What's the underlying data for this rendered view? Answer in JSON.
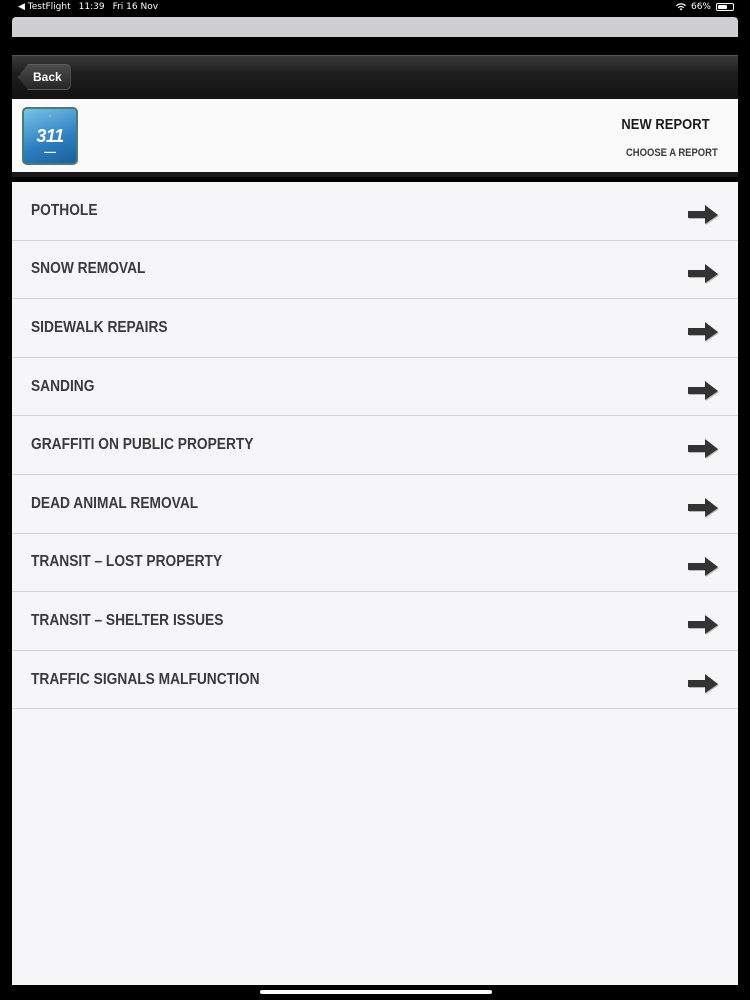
{
  "status_bar": {
    "app": "◀ TestFlight",
    "time": "11:39",
    "date": "Fri 16 Nov",
    "battery": "66%",
    "battery_level": 0.66
  },
  "nav": {
    "back_label": "Back"
  },
  "header": {
    "logo_text": "311",
    "title": "NEW REPORT",
    "subtitle": "CHOOSE A REPORT"
  },
  "items": [
    {
      "label": "POTHOLE"
    },
    {
      "label": "SNOW REMOVAL"
    },
    {
      "label": "SIDEWALK REPAIRS"
    },
    {
      "label": "SANDING"
    },
    {
      "label": "GRAFFITI ON PUBLIC PROPERTY"
    },
    {
      "label": "DEAD ANIMAL REMOVAL"
    },
    {
      "label": "TRANSIT – LOST PROPERTY"
    },
    {
      "label": "TRANSIT – SHELTER ISSUES"
    },
    {
      "label": "TRAFFIC SIGNALS MALFUNCTION"
    }
  ],
  "icons": {
    "row_arrow": "arrow-right-icon"
  }
}
